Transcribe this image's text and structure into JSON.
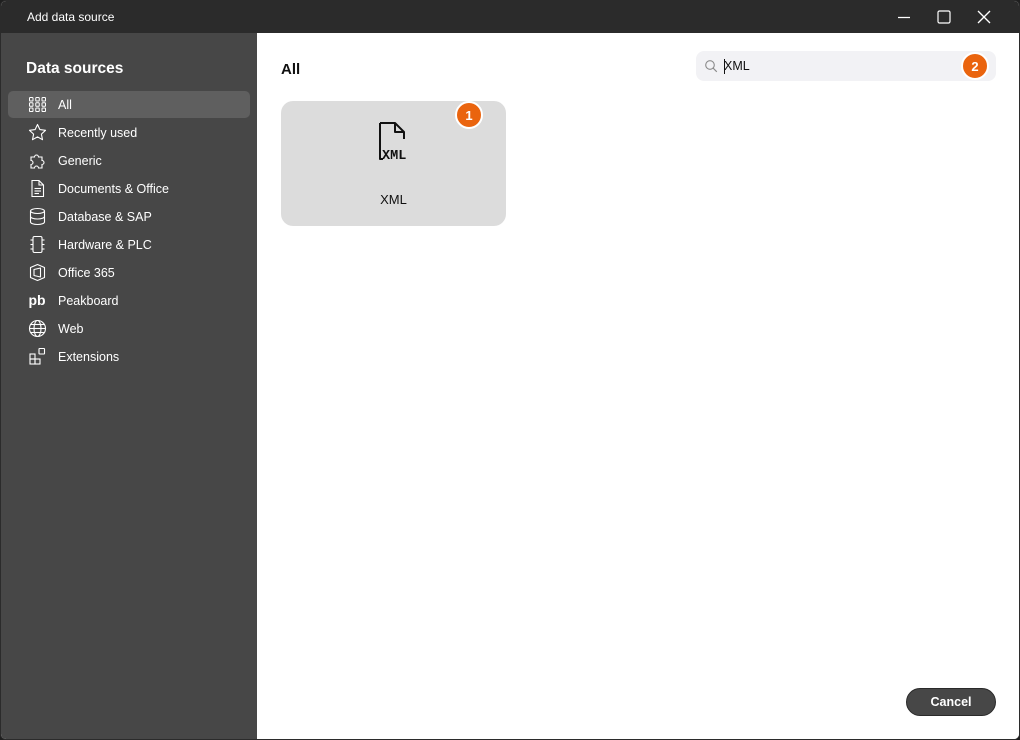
{
  "window": {
    "title": "Add data source",
    "controls": [
      "minimize-icon",
      "maximize-icon",
      "close-icon"
    ]
  },
  "sidebar": {
    "heading": "Data sources",
    "items": [
      {
        "label": "All",
        "icon": "grid-icon",
        "active": true
      },
      {
        "label": "Recently used",
        "icon": "star-icon"
      },
      {
        "label": "Generic",
        "icon": "puzzle-icon"
      },
      {
        "label": "Documents & Office",
        "icon": "document-icon"
      },
      {
        "label": "Database & SAP",
        "icon": "database-icon"
      },
      {
        "label": "Hardware & PLC",
        "icon": "chip-icon"
      },
      {
        "label": "Office 365",
        "icon": "office-icon"
      },
      {
        "label": "Peakboard",
        "icon": "peakboard-icon",
        "icon_text": "pb"
      },
      {
        "label": "Web",
        "icon": "globe-icon"
      },
      {
        "label": "Extensions",
        "icon": "extensions-icon"
      }
    ]
  },
  "main": {
    "title": "All",
    "search": {
      "value": "XML",
      "icon": "search-icon"
    },
    "tiles": [
      {
        "label": "XML",
        "icon": "xml-file-icon",
        "icon_text": "XML"
      }
    ],
    "badges": [
      "1",
      "2"
    ],
    "cancel_label": "Cancel"
  },
  "colors": {
    "titlebar": "#2b2b2b",
    "sidebar": "#474747",
    "sidebar_active": "#5f5f5f",
    "tile": "#dcdcdc",
    "badge": "#ea640e",
    "search_bg": "#f2f2f5"
  }
}
